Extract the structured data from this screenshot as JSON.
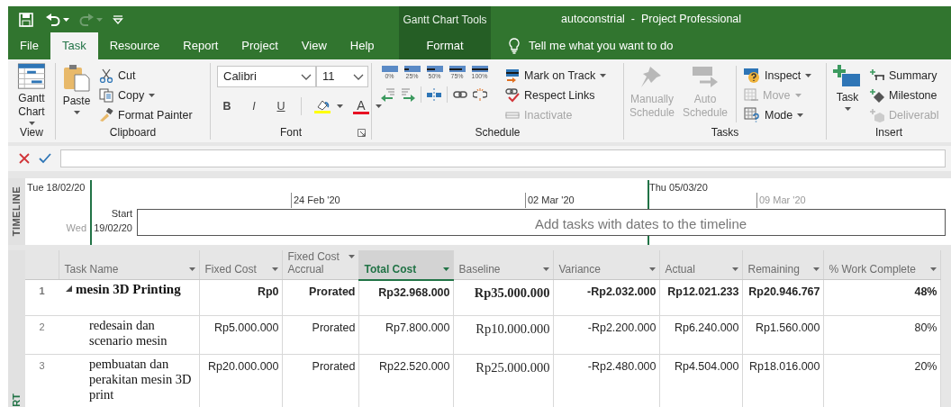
{
  "quick_access": [
    {
      "kind": "save",
      "disabled": false,
      "dropdown": false
    },
    {
      "kind": "undo",
      "disabled": false,
      "dropdown": true
    },
    {
      "kind": "redo",
      "disabled": true,
      "dropdown": true
    },
    {
      "kind": "customize",
      "disabled": false,
      "dropdown": false
    }
  ],
  "title_bar": {
    "contextual_group": "Gantt Chart Tools",
    "title": "autoconstrial  -  Project Professional"
  },
  "ribbon_tabs": [
    {
      "label": "File",
      "selected": false,
      "kind": "tab"
    },
    {
      "label": "Task",
      "selected": true,
      "kind": "tab"
    },
    {
      "label": "Resource",
      "selected": false,
      "kind": "tab"
    },
    {
      "label": "Report",
      "selected": false,
      "kind": "tab"
    },
    {
      "label": "Project",
      "selected": false,
      "kind": "tab"
    },
    {
      "label": "View",
      "selected": false,
      "kind": "tab"
    },
    {
      "label": "Help",
      "selected": false,
      "kind": "tab"
    },
    {
      "label": "Format",
      "selected": false,
      "kind": "contextual"
    }
  ],
  "tell_me": "Tell me what you want to do",
  "ribbon": {
    "groups": [
      {
        "label": "View",
        "items": [
          {
            "kind": "large",
            "label": "Gantt Chart",
            "dropdown": true,
            "disabled": false
          }
        ]
      },
      {
        "label": "Clipboard",
        "items": [
          {
            "kind": "large",
            "label": "Paste",
            "dropdown": true,
            "disabled": false
          },
          {
            "kind": "small",
            "label": "Cut",
            "dropdown": false,
            "disabled": false
          },
          {
            "kind": "small",
            "label": "Copy",
            "dropdown": true,
            "disabled": false
          },
          {
            "kind": "small",
            "label": "Format Painter",
            "dropdown": false,
            "disabled": false
          }
        ]
      },
      {
        "label": "Font",
        "dialog_launcher": true,
        "items": [
          {
            "kind": "combo",
            "value": "Calibri"
          },
          {
            "kind": "combo",
            "value": "11"
          },
          {
            "kind": "format",
            "label": "B"
          },
          {
            "kind": "format",
            "label": "I"
          },
          {
            "kind": "format",
            "label": "U"
          },
          {
            "kind": "color",
            "color": "#ffff00",
            "dropdown": true
          },
          {
            "kind": "color",
            "label": "A",
            "color": "#e81123",
            "dropdown": true
          }
        ]
      },
      {
        "label": "Schedule",
        "items": [
          {
            "kind": "percent",
            "label": "0%"
          },
          {
            "kind": "percent",
            "label": "25%"
          },
          {
            "kind": "percent",
            "label": "50%"
          },
          {
            "kind": "percent",
            "label": "75%"
          },
          {
            "kind": "percent",
            "label": "100%"
          },
          {
            "kind": "icon",
            "disabled": false
          },
          {
            "kind": "icon",
            "disabled": false
          },
          {
            "kind": "icon",
            "disabled": false
          },
          {
            "kind": "icon",
            "disabled": false
          },
          {
            "kind": "icon",
            "disabled": false
          },
          {
            "kind": "small",
            "label": "Mark on Track",
            "dropdown": true,
            "disabled": false
          },
          {
            "kind": "small",
            "label": "Respect Links",
            "dropdown": false,
            "disabled": false
          },
          {
            "kind": "small",
            "label": "Inactivate",
            "dropdown": false,
            "disabled": true
          }
        ]
      },
      {
        "label": "Tasks",
        "items": [
          {
            "kind": "large",
            "label": "Manually Schedule",
            "dropdown": false,
            "disabled": true
          },
          {
            "kind": "large",
            "label": "Auto Schedule",
            "dropdown": false,
            "disabled": true
          },
          {
            "kind": "small",
            "label": "Inspect",
            "dropdown": true,
            "disabled": false
          },
          {
            "kind": "small",
            "label": "Move",
            "dropdown": true,
            "disabled": true
          },
          {
            "kind": "small",
            "label": "Mode",
            "dropdown": true,
            "disabled": false
          }
        ]
      },
      {
        "label": "Insert",
        "items": [
          {
            "kind": "large",
            "label": "Task",
            "dropdown": true,
            "disabled": false
          },
          {
            "kind": "small",
            "label": "Summary",
            "dropdown": false,
            "disabled": false
          },
          {
            "kind": "small",
            "label": "Milestone",
            "dropdown": false,
            "disabled": false
          },
          {
            "kind": "small",
            "label": "Deliverabl",
            "dropdown": false,
            "disabled": true
          }
        ]
      }
    ]
  },
  "timeline": {
    "label": "TIMELINE",
    "start_date": "Tue 18/02/20",
    "finish_date": "Thu 05/03/20",
    "ticks": [
      {
        "label": "24 Feb '20",
        "in_range": true
      },
      {
        "label": "02 Mar '20",
        "in_range": true
      },
      {
        "label": "09 Mar '20",
        "in_range": false
      }
    ],
    "start_label": "Start",
    "start_day": "Wed",
    "start_value": "19/02/20",
    "placeholder": "Add tasks with dates to the timeline"
  },
  "view_bar": {
    "label": "RT"
  },
  "table": {
    "columns": [
      {
        "label": "Task Name",
        "selected": false
      },
      {
        "label": "Fixed Cost",
        "selected": false
      },
      {
        "label": "Fixed Cost Accrual",
        "selected": false
      },
      {
        "label": "Total Cost",
        "selected": true
      },
      {
        "label": "Baseline",
        "selected": false
      },
      {
        "label": "Variance",
        "selected": false
      },
      {
        "label": "Actual",
        "selected": false
      },
      {
        "label": "Remaining",
        "selected": false
      },
      {
        "label": "% Work Complete",
        "selected": false
      }
    ],
    "rows": [
      {
        "id": "1",
        "kind": "summary",
        "expanded": true,
        "cells": [
          "mesin 3D Printing",
          "Rp0",
          "Prorated",
          "Rp32.968.000",
          "Rp35.000.000",
          "-Rp2.032.000",
          "Rp12.021.233",
          "Rp20.946.767",
          "48%"
        ],
        "children": [
          {
            "id": "2",
            "kind": "task",
            "cells": [
              "redesain dan scenario mesin",
              "Rp5.000.000",
              "Prorated",
              "Rp7.800.000",
              "Rp10.000.000",
              "-Rp2.200.000",
              "Rp6.240.000",
              "Rp1.560.000",
              "80%"
            ]
          },
          {
            "id": "3",
            "kind": "task",
            "cells": [
              "pembuatan dan perakitan mesin 3D print",
              "Rp20.000.000",
              "Prorated",
              "Rp22.520.000",
              "Rp25.000.000",
              "-Rp2.480.000",
              "Rp4.504.000",
              "Rp18.016.000",
              "20%"
            ]
          }
        ]
      }
    ]
  }
}
